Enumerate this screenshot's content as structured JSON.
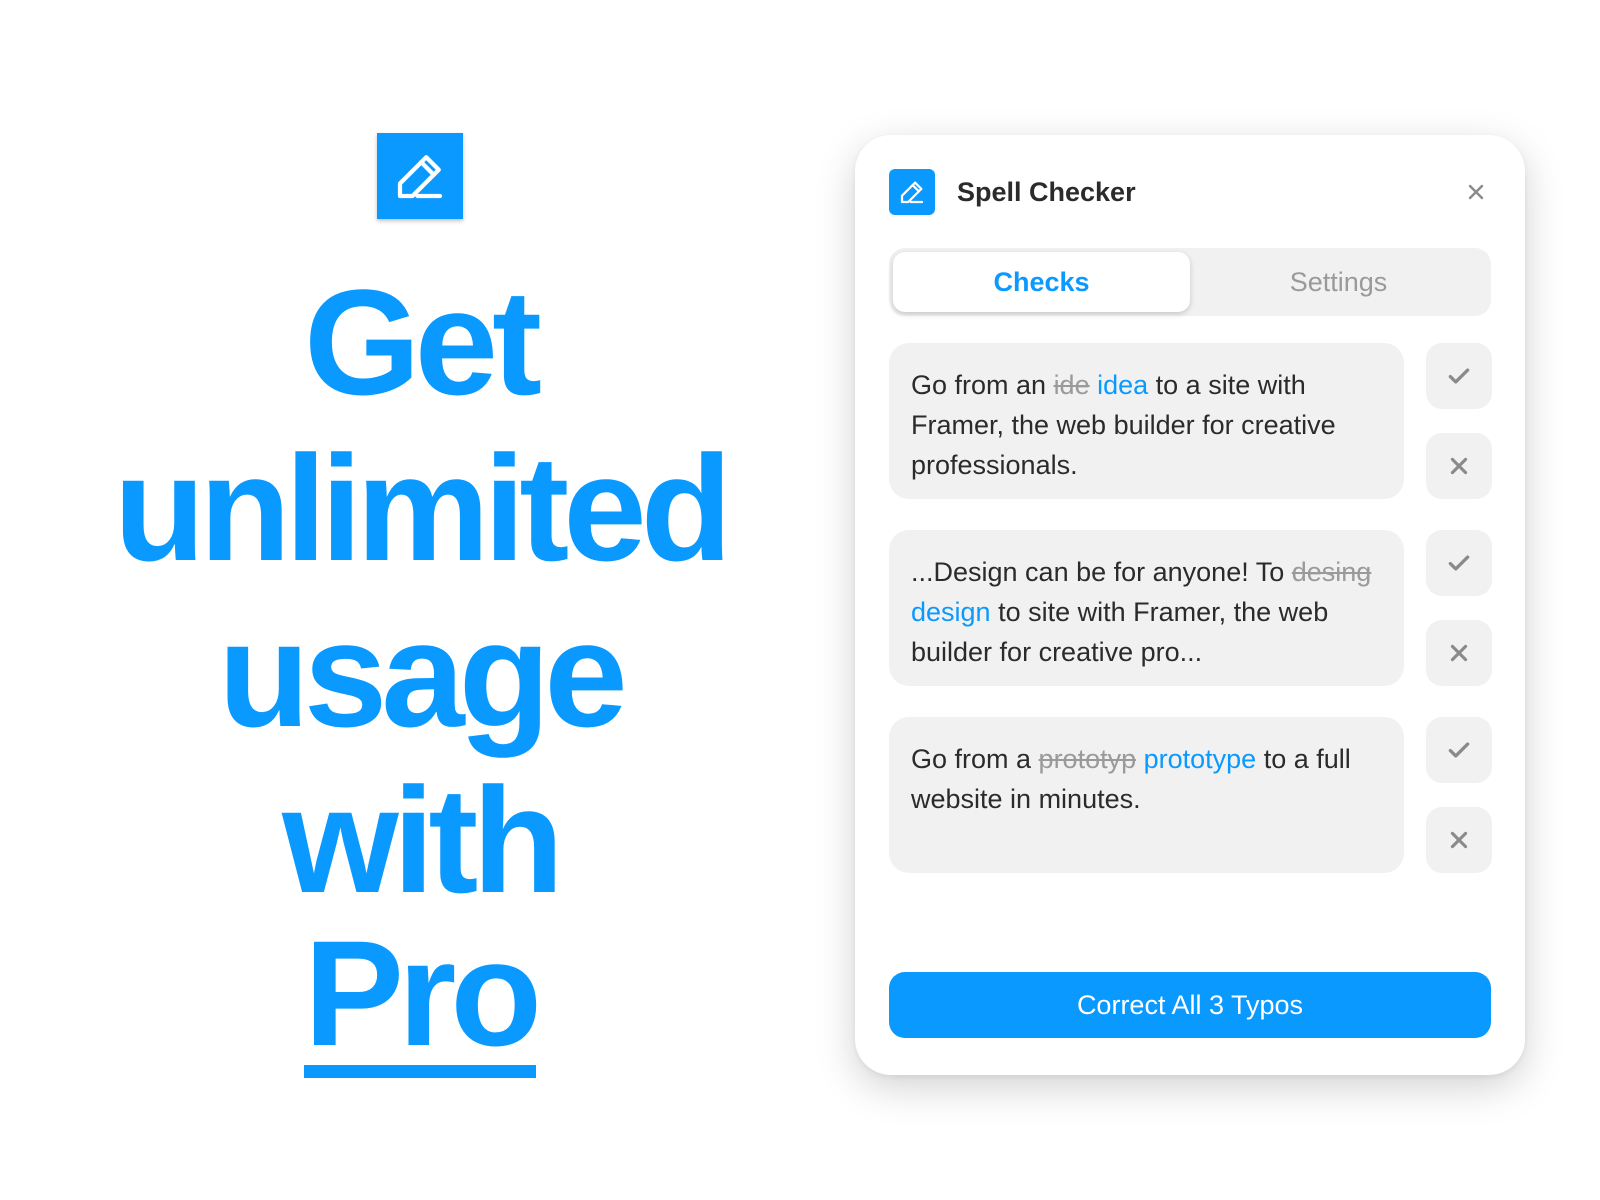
{
  "promo": {
    "logo_icon": "pencil-edit-icon",
    "headline_lines": [
      "Get",
      "unlimited",
      "usage",
      "with"
    ],
    "headline_emphasis": "Pro",
    "accent_color": "#0a99ff"
  },
  "panel": {
    "title": "Spell Checker",
    "app_icon": "pencil-edit-icon",
    "close_icon": "close-icon",
    "tabs": [
      {
        "label": "Checks",
        "active": true
      },
      {
        "label": "Settings",
        "active": false
      }
    ],
    "checks": [
      {
        "before": "Go from an ",
        "wrong": "ide",
        "right": "idea",
        "after": " to a site with Framer, the web builder for creative professionals.",
        "accept_icon": "checkmark-icon",
        "reject_icon": "close-icon"
      },
      {
        "before": "...Design can be for anyone! To ",
        "wrong": "desing",
        "right": "design",
        "after": " to site with Framer, the web builder for creative pro...",
        "accept_icon": "checkmark-icon",
        "reject_icon": "close-icon"
      },
      {
        "before": "Go from a ",
        "wrong": "prototyp",
        "right": "prototype",
        "after": " to a full website in minutes.",
        "accept_icon": "checkmark-icon",
        "reject_icon": "close-icon"
      }
    ],
    "correct_all_label": "Correct All 3 Typos"
  }
}
